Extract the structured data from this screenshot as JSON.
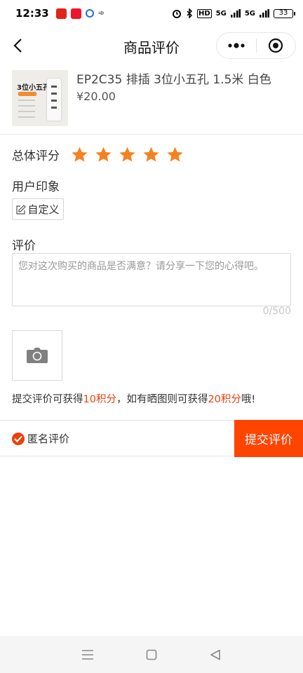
{
  "status_bar": {
    "time": "12:33",
    "network_badge": "HD",
    "signal1": "5G",
    "signal2": "5G",
    "battery": "33"
  },
  "nav": {
    "title": "商品评价",
    "back_icon": "chevron-left-icon",
    "more_icon": "more-dots-icon",
    "close_icon": "target-circle-icon"
  },
  "product": {
    "thumb_text": "3位小五孔",
    "name": "EP2C35 排插 3位小五孔 1.5米 白色",
    "price": "¥20.00"
  },
  "rating": {
    "label": "总体评分",
    "stars": 5,
    "max": 5,
    "star_color": "#f58220"
  },
  "impression": {
    "label": "用户印象",
    "custom_tag": "自定义",
    "edit_icon": "edit-icon"
  },
  "review": {
    "label": "评价",
    "placeholder": "您对这次购买的商品是否满意？请分享一下您的心得吧。",
    "counter": "0/500",
    "camera_icon": "camera-icon"
  },
  "points_note": {
    "prefix": "提交评价可获得",
    "points1": "10积分",
    "middle": "，如有晒图则可获得",
    "points2": "20积分",
    "suffix": "哦!"
  },
  "action_bar": {
    "anonymous_label": "匿名评价",
    "anonymous_checked": true,
    "submit_label": "提交评价"
  },
  "colors": {
    "accent": "#ff4400",
    "highlight": "#e8410f"
  }
}
